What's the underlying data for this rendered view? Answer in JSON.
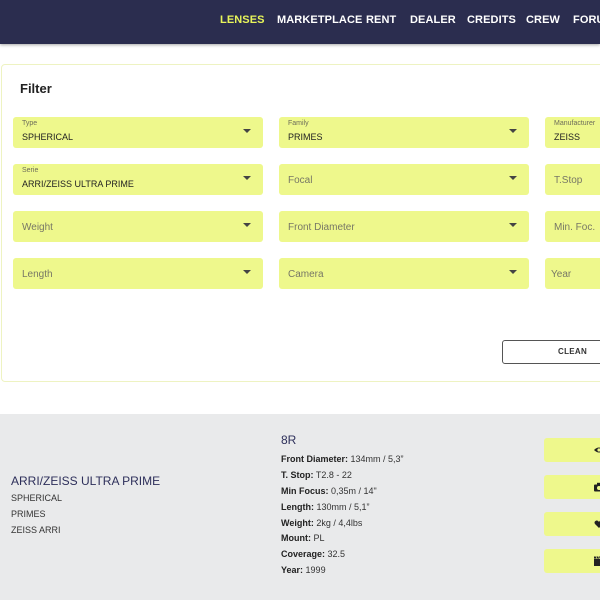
{
  "nav": {
    "items": [
      {
        "label": "LENSES",
        "active": true
      },
      {
        "label": "MARKETPLACE",
        "active": false
      },
      {
        "label": "RENT",
        "active": false
      },
      {
        "label": "DEALER",
        "active": false
      },
      {
        "label": "CREDITS",
        "active": false
      },
      {
        "label": "CREW",
        "active": false
      },
      {
        "label": "FORUM",
        "active": false
      }
    ]
  },
  "filter": {
    "title": "Filter",
    "type": {
      "label": "Type",
      "value": "SPHERICAL"
    },
    "family": {
      "label": "Family",
      "value": "PRIMES"
    },
    "manufacturer": {
      "label": "Manufacturer",
      "value": "ZEISS"
    },
    "serie": {
      "label": "Serie",
      "value": "ARRI/ZEISS ULTRA PRIME"
    },
    "focal": {
      "placeholder": "Focal"
    },
    "tstop": {
      "placeholder": "T.Stop"
    },
    "weight": {
      "placeholder": "Weight"
    },
    "front_diameter": {
      "placeholder": "Front Diameter"
    },
    "min_focus": {
      "placeholder": "Min. Foc."
    },
    "length": {
      "placeholder": "Length"
    },
    "camera": {
      "placeholder": "Camera"
    },
    "year": {
      "placeholder": "Year"
    },
    "clean_label": "CLEAN"
  },
  "result": {
    "name": "ARRI/ZEISS ULTRA PRIME",
    "type": "SPHERICAL",
    "family": "PRIMES",
    "manufacturer": "ZEISS ARRI",
    "model": "8R",
    "specs": [
      {
        "label": "Front Diameter:",
        "value": "134mm / 5,3”"
      },
      {
        "label": "T. Stop:",
        "value": "T2.8 - 22"
      },
      {
        "label": "Min Focus:",
        "value": "0,35m / 14\""
      },
      {
        "label": "Length:",
        "value": "130mm / 5,1”"
      },
      {
        "label": "Weight:",
        "value": "2kg / 4,4lbs"
      },
      {
        "label": "Mount:",
        "value": "PL"
      },
      {
        "label": "Coverage:",
        "value": "32.5"
      },
      {
        "label": "Year:",
        "value": "1999"
      }
    ],
    "actions": [
      {
        "icon": "eye-icon"
      },
      {
        "icon": "camera-icon"
      },
      {
        "icon": "heart-icon"
      },
      {
        "icon": "clapperboard-icon"
      }
    ]
  },
  "colors": {
    "nav_bg": "#2b2d4f",
    "nav_active": "#e8f55a",
    "accent": "#eef88c",
    "result_bg": "#e9eaeb",
    "title_navy": "#2d2f5a"
  }
}
